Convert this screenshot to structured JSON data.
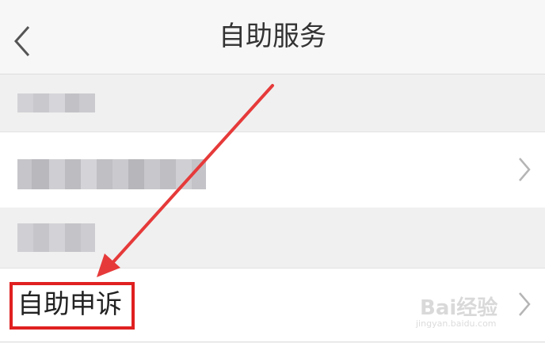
{
  "nav": {
    "title": "自助服务",
    "back_icon": "chevron-left-icon"
  },
  "rows": {
    "appeal": {
      "label": "自助申诉",
      "chevron_icon": "chevron-right-icon"
    }
  },
  "watermark": {
    "brand": "Bai经验",
    "url": "jingyan.baidu.com"
  },
  "annotation": {
    "highlight_color": "#e02020"
  }
}
